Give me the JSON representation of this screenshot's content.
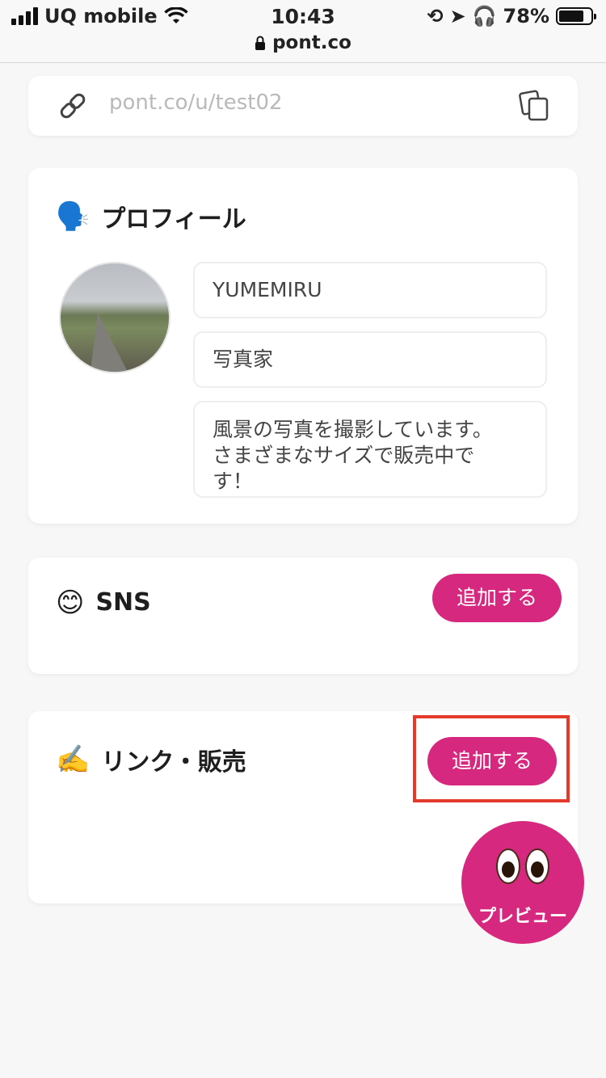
{
  "status_bar": {
    "carrier": "UQ mobile",
    "time": "10:43",
    "battery_percent": "78%",
    "battery_level": 0.78,
    "url": "pont.co"
  },
  "url_card": {
    "url_value": "pont.co/u/test02",
    "icons": {
      "link": "link-icon",
      "copy": "copy-icon"
    }
  },
  "profile": {
    "emoji": "🗣️",
    "title": "プロフィール",
    "name": "YUMEMIRU",
    "occupation": "写真家",
    "bio": "風景の写真を撮影しています。\nさまざまなサイズで販売中で\nす！"
  },
  "sns": {
    "emoji": "😊",
    "title": "SNS",
    "add_label": "追加する"
  },
  "links": {
    "emoji": "✍️",
    "title": "リンク・販売",
    "add_label": "追加する"
  },
  "preview": {
    "label": "プレビュー"
  },
  "colors": {
    "accent": "#d6287e",
    "highlight": "#e33a2c",
    "background": "#f7f7f7"
  }
}
